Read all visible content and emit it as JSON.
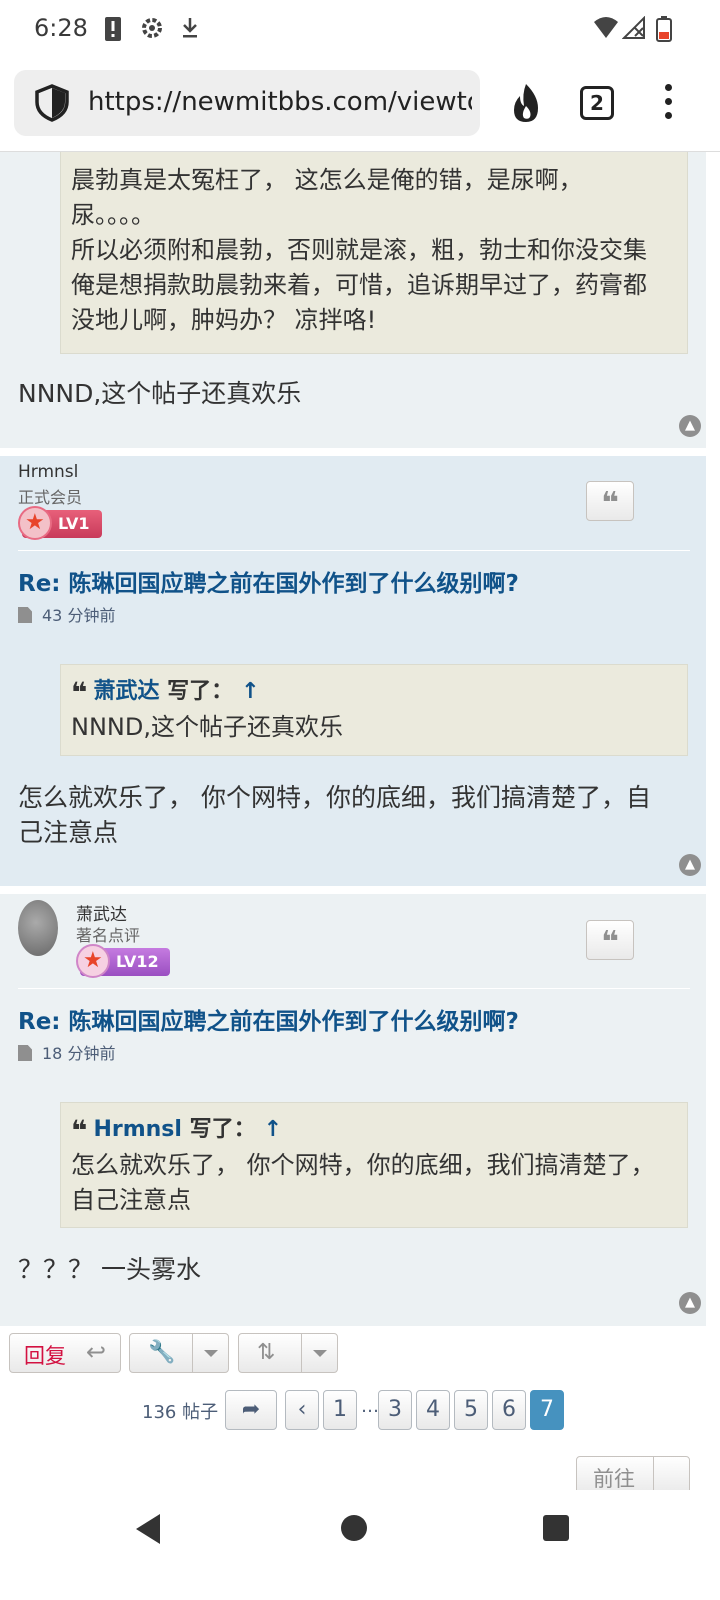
{
  "status_bar": {
    "time": "6:28",
    "icons": [
      "alert-icon",
      "settings-icon",
      "download-icon",
      "wifi-icon",
      "signal-icon",
      "battery-icon"
    ]
  },
  "browser": {
    "url": "https://newmitbbs.com/viewtopic",
    "tab_count": "2"
  },
  "posts": [
    {
      "quote_lines": [
        "晨勃真是太冤枉了， 这怎么是俺的错，是尿啊，",
        "尿。。。。",
        "所以必须附和晨勃，否则就是滚，粗，勃士和你没交集",
        "俺是想捐款助晨勃来着，可惜，追诉期早过了，药膏都",
        "没地儿啊，肿妈办？ 凉拌咯!"
      ],
      "text": "NNND,这个帖子还真欢乐"
    },
    {
      "username": "Hrmnsl",
      "rank": "正式会员",
      "level": "LV1",
      "title": "Re: 陈琳回国应聘之前在国外作到了什么级别啊?",
      "time": "43 分钟前",
      "quote_author": "萧武达",
      "quote_wrote": "写了：",
      "quote_lines": [
        "NNND,这个帖子还真欢乐"
      ],
      "text_lines": [
        "怎么就欢乐了， 你个网特，你的底细，我们搞清楚了，自",
        "己注意点"
      ]
    },
    {
      "username": "萧武达",
      "rank": "著名点评",
      "level": "LV12",
      "title": "Re: 陈琳回国应聘之前在国外作到了什么级别啊?",
      "time": "18 分钟前",
      "quote_author": "Hrmnsl",
      "quote_wrote": "写了：",
      "quote_lines": [
        "怎么就欢乐了， 你个网特，你的底细，我们搞清楚了，",
        "自己注意点"
      ],
      "text": "？？？ 一头雾水"
    }
  ],
  "actions": {
    "reply_label": "回复",
    "post_count": "136 帖子",
    "pages": [
      "1",
      "3",
      "4",
      "5",
      "6",
      "7"
    ],
    "ellipsis": "…",
    "active_page": "7",
    "jump_label": "前往"
  },
  "colors": {
    "link": "#105289",
    "reply": "#d31141",
    "active_page": "#4692bf"
  }
}
